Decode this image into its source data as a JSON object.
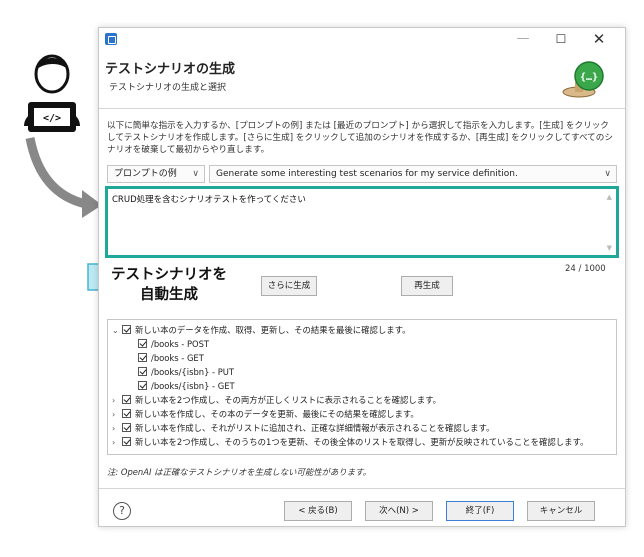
{
  "window": {
    "title": "テストシナリオの生成",
    "subtitle": "テストシナリオの生成と選択",
    "min_glyph": "—",
    "max_glyph": "☐",
    "close_glyph": "✕"
  },
  "instructions": "以下に簡単な指示を入力するか、[プロンプトの例] または [最近のプロンプト] から選択して指示を入力します。[生成] をクリックしてテストシナリオを作成します。[さらに生成] をクリックして追加のシナリオを作成するか、[再生成] をクリックしてすべてのシナリオを破棄して最初からやり直します。",
  "prompt_selector": {
    "label": "プロンプトの例",
    "selected": "Generate some interesting test scenarios for my service definition."
  },
  "prompt_input": {
    "value": "CRUD処理を含むシナリオテストを作ってください"
  },
  "counter": "24 / 1000",
  "buttons": {
    "more": "さらに生成",
    "regenerate": "再生成",
    "back": "< 戻る(B)",
    "next": "次へ(N) >",
    "finish": "終了(F)",
    "cancel": "キャンセル"
  },
  "scenarios": [
    {
      "label": "新しい本のデータを作成、取得、更新し、その結果を最後に確認します。",
      "expanded": true,
      "checked": true,
      "children": [
        {
          "label": "/books - POST",
          "checked": true
        },
        {
          "label": "/books - GET",
          "checked": true
        },
        {
          "label": "/books/{isbn} - PUT",
          "checked": true
        },
        {
          "label": "/books/{isbn} - GET",
          "checked": true
        }
      ]
    },
    {
      "label": "新しい本を2つ作成し、その両方が正しくリストに表示されることを確認します。",
      "expanded": false,
      "checked": true
    },
    {
      "label": "新しい本を作成し、その本のデータを更新、最後にその結果を確認します。",
      "expanded": false,
      "checked": true
    },
    {
      "label": "新しい本を作成し、それがリストに追加され、正確な詳細情報が表示されることを確認します。",
      "expanded": false,
      "checked": true
    },
    {
      "label": "新しい本を2つ作成し、そのうちの1つを更新、その後全体のリストを取得し、更新が反映されていることを確認します。",
      "expanded": false,
      "checked": true
    }
  ],
  "note": "注: OpenAI は正確なテストシナリオを生成しない可能性があります。",
  "help_glyph": "?",
  "callout": {
    "line1": "テストシナリオを",
    "line2": "自動生成"
  },
  "colors": {
    "accent": "#1fa89a",
    "callout_fill": "#bde9f3",
    "callout_stroke": "#48b4d4",
    "arrow": "#888888"
  }
}
